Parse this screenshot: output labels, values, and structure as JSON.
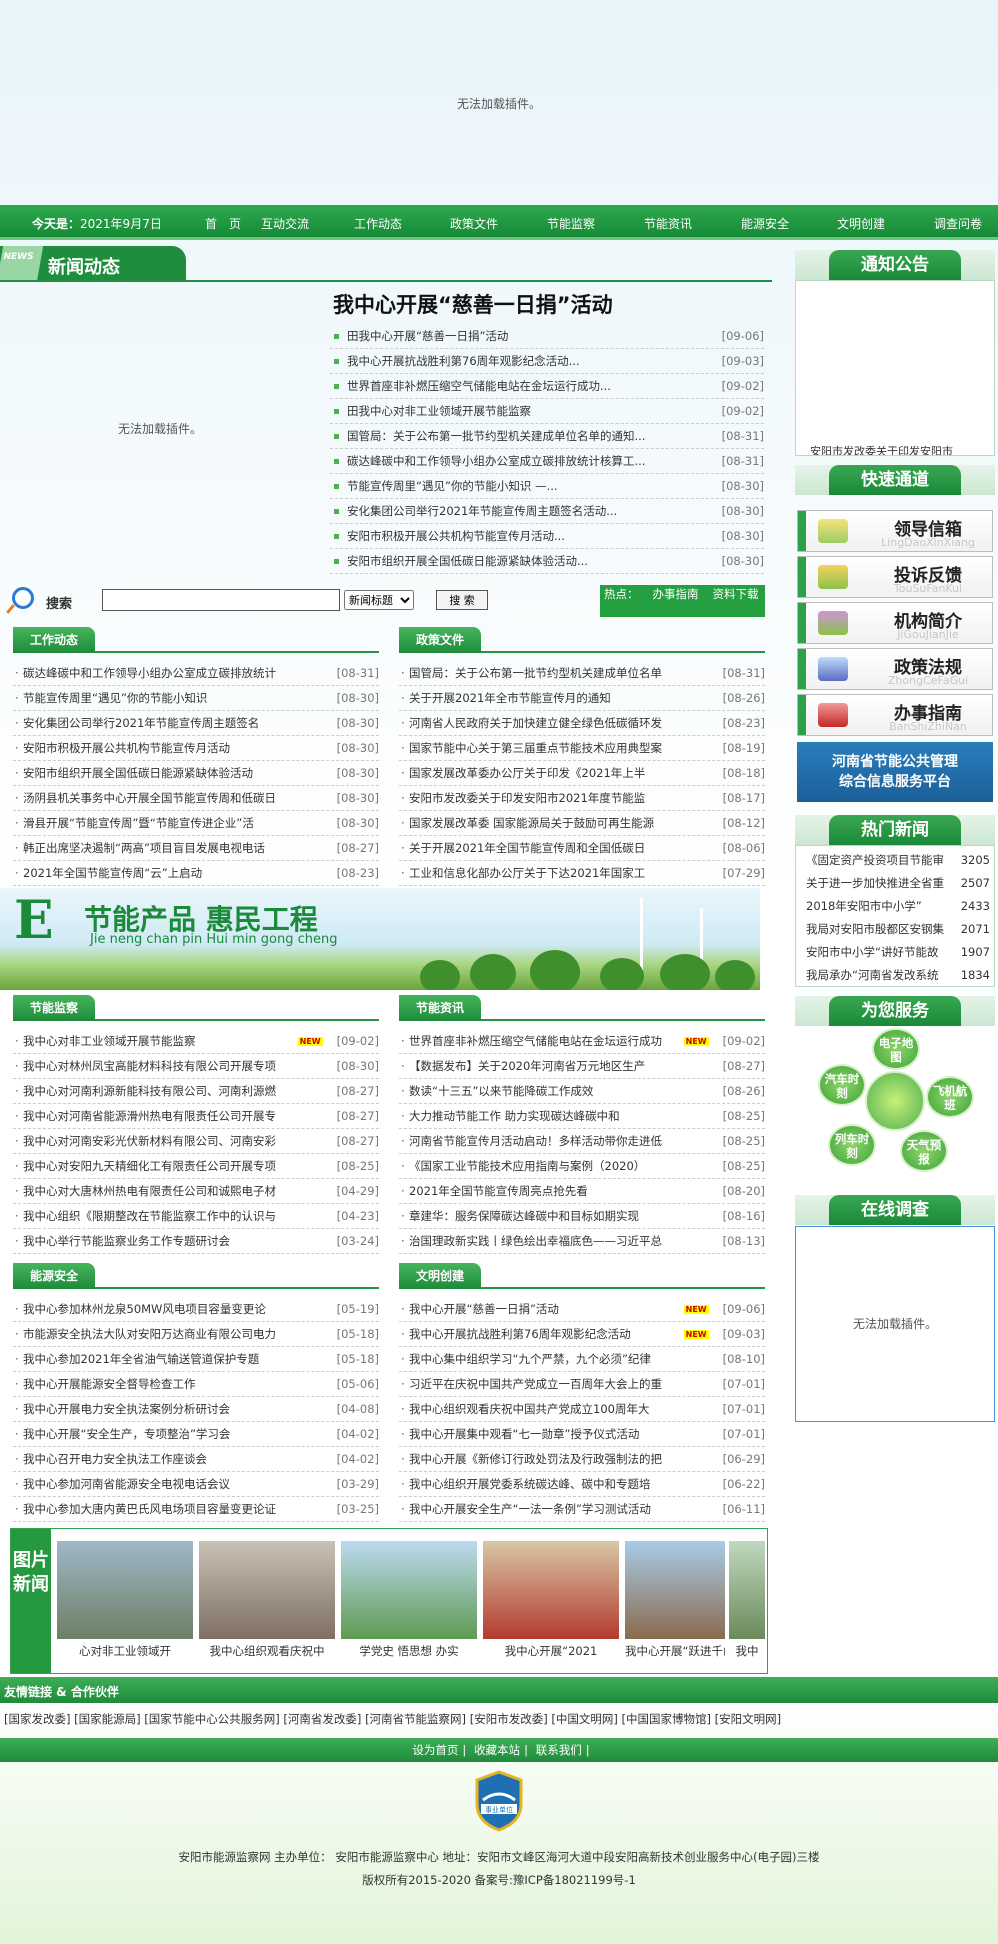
{
  "top_banner": {
    "plugin_message": "无法加载插件。"
  },
  "navbar": {
    "date_label": "今天是：",
    "date_value": "2021年9月7日",
    "items": [
      "首　页",
      "互动交流",
      "工作动态",
      "政策文件",
      "节能监察",
      "节能资讯",
      "能源安全",
      "文明创建",
      "调查问卷"
    ]
  },
  "news_section": {
    "tag": "NEWS",
    "title": "新闻动态",
    "plugin_message": "无法加载插件。",
    "headline": "我中心开展“慈善一日捐”活动",
    "items": [
      {
        "text": "田我中心开展“慈善一日捐”活动",
        "date": "[09-06]"
      },
      {
        "text": "我中心开展抗战胜利第76周年观影纪念活动...",
        "date": "[09-03]"
      },
      {
        "text": "世界首座非补燃压缩空气储能电站在金坛运行成功...",
        "date": "[09-02]"
      },
      {
        "text": "田我中心对非工业领域开展节能监察",
        "date": "[09-02]"
      },
      {
        "text": "国管局：关于公布第一批节约型机关建成单位名单的通知...",
        "date": "[08-31]"
      },
      {
        "text": "碳达峰碳中和工作领导小组办公室成立碳排放统计核算工...",
        "date": "[08-31]"
      },
      {
        "text": "节能宣传周里“遇见”你的节能小知识 —...",
        "date": "[08-30]"
      },
      {
        "text": "安化集团公司举行2021年节能宣传周主题签名活动...",
        "date": "[08-30]"
      },
      {
        "text": "安阳市积极开展公共机构节能宣传月活动...",
        "date": "[08-30]"
      },
      {
        "text": "安阳市组织开展全国低碳日能源紧缺体验活动...",
        "date": "[08-30]"
      }
    ]
  },
  "search": {
    "label": "搜索",
    "placeholder": "",
    "select_value": "新闻标题",
    "button": "搜 索",
    "hot_label": "热点：",
    "hot_links": [
      "办事指南",
      "资料下载"
    ]
  },
  "categories": {
    "work": {
      "title": "工作动态",
      "rows": [
        {
          "text": "碳达峰碳中和工作领导小组办公室成立碳排放统计",
          "date": "[08-31]"
        },
        {
          "text": "节能宣传周里“遇见”你的节能小知识",
          "date": "[08-30]"
        },
        {
          "text": "安化集团公司举行2021年节能宣传周主题签名",
          "date": "[08-30]"
        },
        {
          "text": "安阳市积极开展公共机构节能宣传月活动",
          "date": "[08-30]"
        },
        {
          "text": "安阳市组织开展全国低碳日能源紧缺体验活动",
          "date": "[08-30]"
        },
        {
          "text": "汤阴县机关事务中心开展全国节能宣传周和低碳日",
          "date": "[08-30]"
        },
        {
          "text": "滑县开展“节能宣传周”暨“节能宣传进企业”活",
          "date": "[08-30]"
        },
        {
          "text": "韩正出席坚决遏制“两高”项目盲目发展电视电话",
          "date": "[08-27]"
        },
        {
          "text": "2021年全国节能宣传周“云”上启动",
          "date": "[08-23]"
        }
      ]
    },
    "policy": {
      "title": "政策文件",
      "rows": [
        {
          "text": "国管局：关于公布第一批节约型机关建成单位名单",
          "date": "[08-31]"
        },
        {
          "text": "关于开展2021年全市节能宣传月的通知",
          "date": "[08-26]"
        },
        {
          "text": "河南省人民政府关于加快建立健全绿色低碳循环发",
          "date": "[08-23]"
        },
        {
          "text": "国家节能中心关于第三届重点节能技术应用典型案",
          "date": "[08-19]"
        },
        {
          "text": "国家发展改革委办公厅关于印发《2021年上半",
          "date": "[08-18]"
        },
        {
          "text": "安阳市发改委关于印发安阳市2021年度节能监",
          "date": "[08-17]"
        },
        {
          "text": "国家发展改革委 国家能源局关于鼓励可再生能源",
          "date": "[08-12]"
        },
        {
          "text": "关于开展2021年全国节能宣传周和全国低碳日",
          "date": "[08-06]"
        },
        {
          "text": "工业和信息化部办公厅关于下达2021年国家工",
          "date": "[07-29]"
        }
      ]
    },
    "inspection": {
      "title": "节能监察",
      "rows": [
        {
          "text": "我中心对非工业领域开展节能监察",
          "date": "[09-02]",
          "new": true
        },
        {
          "text": "我中心对林州凤宝高能材料科技有限公司开展专项",
          "date": "[08-30]"
        },
        {
          "text": "我中心对河南利源新能科技有限公司、河南利源燃",
          "date": "[08-27]"
        },
        {
          "text": "我中心对河南省能源滑州热电有限责任公司开展专",
          "date": "[08-27]"
        },
        {
          "text": "我中心对河南安彩光伏新材料有限公司、河南安彩",
          "date": "[08-27]"
        },
        {
          "text": "我中心对安阳九天精细化工有限责任公司开展专项",
          "date": "[08-25]"
        },
        {
          "text": "我中心对大唐林州热电有限责任公司和诚熙电子材",
          "date": "[04-29]"
        },
        {
          "text": "我中心组织《限期整改在节能监察工作中的认识与",
          "date": "[04-23]"
        },
        {
          "text": "我中心举行节能监察业务工作专题研讨会",
          "date": "[03-24]"
        }
      ]
    },
    "info": {
      "title": "节能资讯",
      "rows": [
        {
          "text": "世界首座非补燃压缩空气储能电站在金坛运行成功",
          "date": "[09-02]",
          "new": true
        },
        {
          "text": "【数据发布】关于2020年河南省万元地区生产",
          "date": "[08-27]"
        },
        {
          "text": "数读“十三五”以来节能降碳工作成效",
          "date": "[08-26]"
        },
        {
          "text": "大力推动节能工作 助力实现碳达峰碳中和",
          "date": "[08-25]"
        },
        {
          "text": "河南省节能宣传月活动启动！多样活动带你走进低",
          "date": "[08-25]"
        },
        {
          "text": "《国家工业节能技术应用指南与案例（2020）",
          "date": "[08-25]"
        },
        {
          "text": "2021年全国节能宣传周亮点抢先看",
          "date": "[08-20]"
        },
        {
          "text": "章建华：服务保障碳达峰碳中和目标如期实现",
          "date": "[08-16]"
        },
        {
          "text": "治国理政新实践丨绿色绘出幸福底色——习近平总",
          "date": "[08-13]"
        }
      ]
    },
    "safety": {
      "title": "能源安全",
      "rows": [
        {
          "text": "我中心参加林州龙泉50MW风电项目容量变更论",
          "date": "[05-19]"
        },
        {
          "text": "市能源安全执法大队对安阳万达商业有限公司电力",
          "date": "[05-18]"
        },
        {
          "text": "我中心参加2021年全省油气输送管道保护专题",
          "date": "[05-18]"
        },
        {
          "text": "我中心开展能源安全督导检查工作",
          "date": "[05-06]"
        },
        {
          "text": "我中心开展电力安全执法案例分析研讨会",
          "date": "[04-08]"
        },
        {
          "text": "我中心开展“安全生产，专项整治”学习会",
          "date": "[04-02]"
        },
        {
          "text": "我中心召开电力安全执法工作座谈会",
          "date": "[04-02]"
        },
        {
          "text": "我中心参加河南省能源安全电视电话会议",
          "date": "[03-29]"
        },
        {
          "text": "我中心参加大唐内黄巴氏风电场项目容量变更论证",
          "date": "[03-25]"
        }
      ]
    },
    "civil": {
      "title": "文明创建",
      "rows": [
        {
          "text": "我中心开展“慈善一日捐”活动",
          "date": "[09-06]",
          "new": true
        },
        {
          "text": "我中心开展抗战胜利第76周年观影纪念活动",
          "date": "[09-03]",
          "new": true
        },
        {
          "text": "我中心集中组织学习“九个严禁，九个必须”纪律",
          "date": "[08-10]"
        },
        {
          "text": "习近平在庆祝中国共产党成立一百周年大会上的重",
          "date": "[07-01]"
        },
        {
          "text": "我中心组织观看庆祝中国共产党成立100周年大",
          "date": "[07-01]"
        },
        {
          "text": "我中心开展集中观看“七一勋章”授予仪式活动",
          "date": "[07-01]"
        },
        {
          "text": "我中心开展《新修订行政处罚法及行政强制法的把",
          "date": "[06-29]"
        },
        {
          "text": "我中心组织开展党委系统碳达峰、碳中和专题培",
          "date": "[06-22]"
        },
        {
          "text": "我中心开展安全生产“一法一条例”学习测试活动",
          "date": "[06-11]"
        }
      ]
    }
  },
  "energy_banner": {
    "title1": "节能产品  惠民工程",
    "title2": "Jie neng chan pin      Hui min gong cheng"
  },
  "photo_news": {
    "title": "图片新闻",
    "captions": [
      "心对非工业领域开",
      "我中心组织观看庆祝中",
      "学党史 悟思想 办实",
      "我中心开展“2021",
      "我中心开展“跃进千山",
      "我中"
    ]
  },
  "sidebar": {
    "notice_title": "通知公告",
    "notice_items": [
      "安阳市发改委关于印发安阳市"
    ],
    "quick_title": "快速通道",
    "quick_links": [
      {
        "label": "领导信箱",
        "pinyin": "LingDaoXinXiang"
      },
      {
        "label": "投诉反馈",
        "pinyin": "TouSuFanKui"
      },
      {
        "label": "机构简介",
        "pinyin": "JiGouJianJie"
      },
      {
        "label": "政策法规",
        "pinyin": "ZhongCeFaGui"
      },
      {
        "label": "办事指南",
        "pinyin": "BanShiZhiNan"
      }
    ],
    "platform_banner": [
      "河南省节能公共管理",
      "综合信息服务平台"
    ],
    "hot_title": "热门新闻",
    "hot_news": [
      {
        "text": "《固定资产投资项目节能审",
        "count": "3205"
      },
      {
        "text": "关于进一步加快推进全省重",
        "count": "2507"
      },
      {
        "text": "2018年安阳市中小学”",
        "count": "2433"
      },
      {
        "text": "我局对安阳市殷都区安钢集",
        "count": "2071"
      },
      {
        "text": "安阳市中小学“讲好节能故",
        "count": "1907"
      },
      {
        "text": "我局承办“河南省发改系统",
        "count": "1834"
      }
    ],
    "service_title": "为您服务",
    "service_items": [
      "电子地图",
      "汽车时刻",
      "飞机航班",
      "列车时刻",
      "天气预报"
    ],
    "survey_title": "在线调查",
    "survey_plugin_message": "无法加载插件。"
  },
  "footer": {
    "links_title": "友情链接 & 合作伙伴",
    "links": [
      "[国家发改委]",
      "[国家能源局]",
      "[国家节能中心公共服务网]",
      "[河南省发改委]",
      "[河南省节能监察网]",
      "[安阳市发改委]",
      "[中国文明网]",
      "[中国国家博物馆]",
      "[安阳文明网]"
    ],
    "util_links": [
      "设为首页",
      "收藏本站",
      "联系我们"
    ],
    "badge_text": "事业单位",
    "line1": "安阳市能源监察网 主办单位： 安阳市能源监察中心 地址：安阳市文峰区海河大道中段安阳高新技术创业服务中心(电子园)三楼",
    "line2": "版权所有2015-2020 备案号:豫ICP备18021199号-1"
  }
}
